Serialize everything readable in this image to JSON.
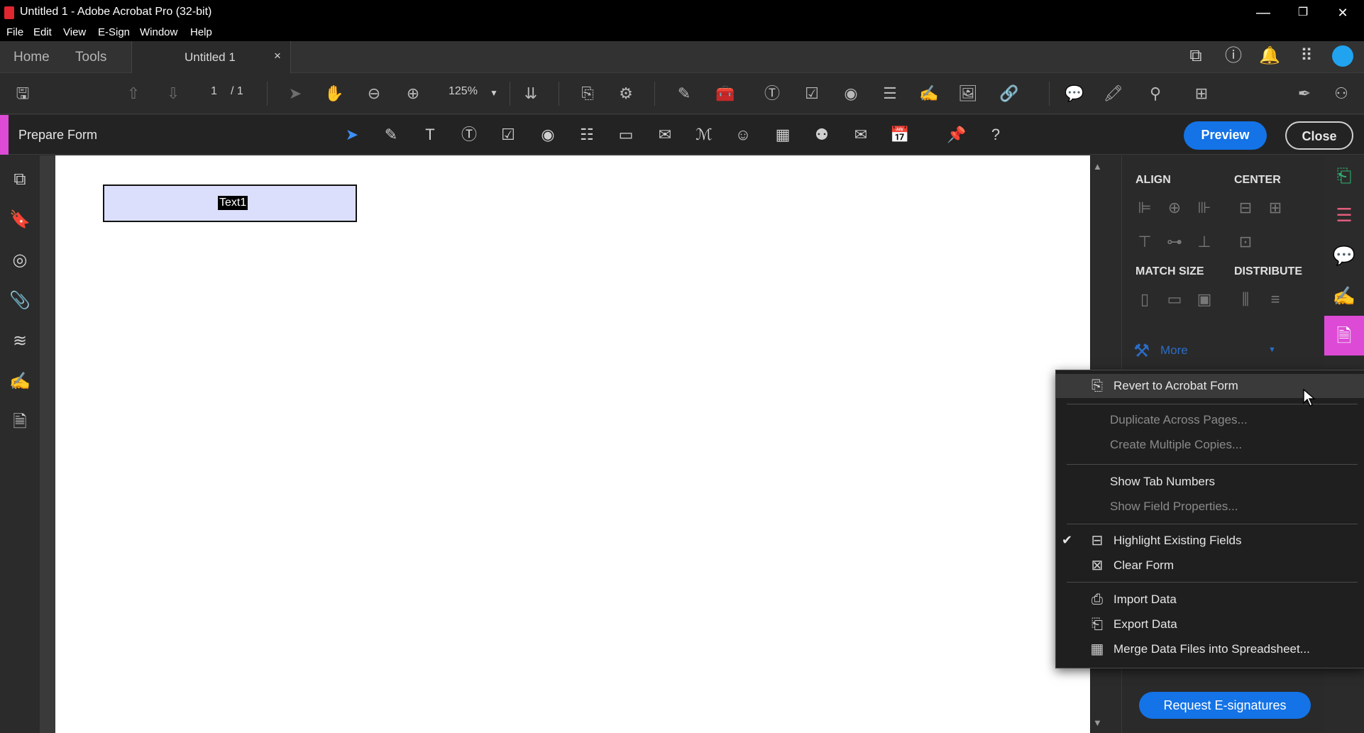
{
  "window": {
    "title": "Untitled 1 - Adobe Acrobat Pro (32-bit)",
    "controls": {
      "minimize": "—",
      "restore": "❐",
      "close": "✕"
    }
  },
  "menubar": [
    "File",
    "Edit",
    "View",
    "E-Sign",
    "Window",
    "Help"
  ],
  "tabs": {
    "home": "Home",
    "tools": "Tools",
    "document": "Untitled 1",
    "close_glyph": "×"
  },
  "toolbar": {
    "page_current": "1",
    "page_total": "/ 1",
    "zoom": "125%"
  },
  "prepare_form": {
    "title": "Prepare Form",
    "preview_label": "Preview",
    "close_label": "Close"
  },
  "document": {
    "field_name": "Text1"
  },
  "right_panel": {
    "align": "ALIGN",
    "center": "CENTER",
    "match_size": "MATCH SIZE",
    "distribute": "DISTRIBUTE",
    "more": "More",
    "request_esign": "Request E-signatures"
  },
  "context_menu": {
    "items": [
      {
        "label": "Revert to Acrobat Form",
        "icon": "revert-form-icon",
        "enabled": true,
        "highlighted": true
      },
      {
        "label": "Duplicate Across Pages...",
        "enabled": false
      },
      {
        "label": "Create Multiple Copies...",
        "enabled": false
      },
      {
        "label": "Show Tab Numbers",
        "enabled": true
      },
      {
        "label": "Show Field Properties...",
        "enabled": false
      },
      {
        "label": "Highlight Existing Fields",
        "icon": "highlight-fields-icon",
        "enabled": true,
        "checked": true
      },
      {
        "label": "Clear Form",
        "icon": "clear-form-icon",
        "enabled": true
      },
      {
        "label": "Import Data",
        "icon": "import-data-icon",
        "enabled": true
      },
      {
        "label": "Export Data",
        "icon": "export-data-icon",
        "enabled": true
      },
      {
        "label": "Merge Data Files into Spreadsheet...",
        "icon": "merge-spreadsheet-icon",
        "enabled": true
      }
    ]
  },
  "colors": {
    "accent_blue": "#1473e6",
    "prepare_form_accent": "#dd4bd6",
    "field_fill": "#dcdffc"
  }
}
